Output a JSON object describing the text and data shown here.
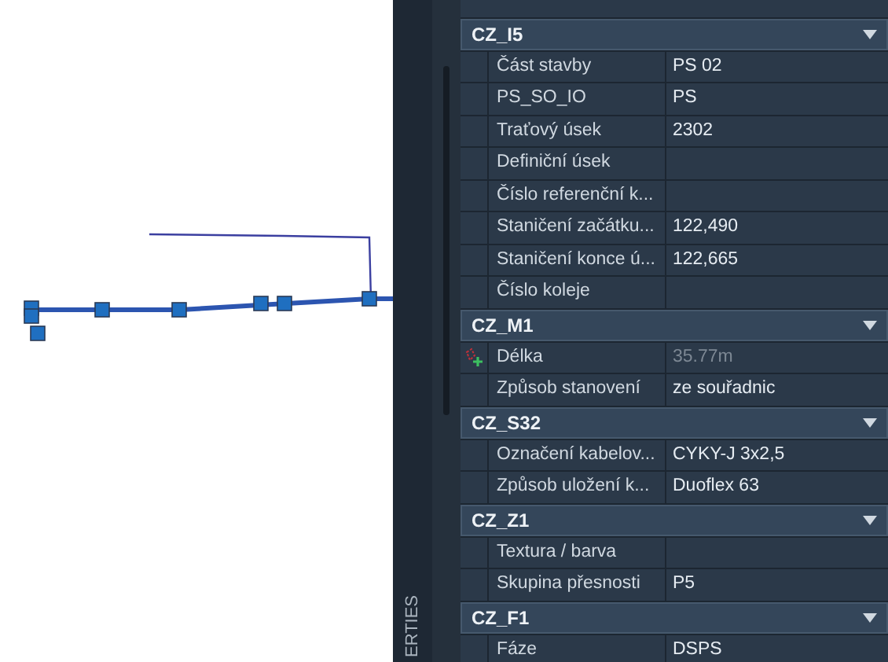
{
  "palette": {
    "tab_title": "ERTIES",
    "groups": [
      {
        "name": "CZ_I5",
        "expanded": true,
        "rows": [
          {
            "label": "Část stavby",
            "value": "PS 02",
            "disabled": false
          },
          {
            "label": "PS_SO_IO",
            "value": "PS",
            "disabled": false
          },
          {
            "label": "Traťový úsek",
            "value": "2302",
            "disabled": false
          },
          {
            "label": "Definiční úsek"
          },
          {
            "label": "Číslo referenční k..."
          },
          {
            "label": "Staničení začátku...",
            "value": "122,490",
            "disabled": false
          },
          {
            "label": "Staničení konce ú...",
            "value": "122,665",
            "disabled": false
          },
          {
            "label": "Číslo koleje"
          }
        ]
      },
      {
        "name": "CZ_M1",
        "expanded": true,
        "rows": [
          {
            "label": "Délka",
            "value": "35.77m",
            "disabled": true,
            "kind": "pick"
          },
          {
            "label": "Způsob stanovení",
            "value": "ze souřadnic",
            "disabled": false
          }
        ]
      },
      {
        "name": "CZ_S32",
        "expanded": true,
        "rows": [
          {
            "label": "Označení kabelov...",
            "value": "CYKY-J 3x2,5",
            "disabled": false
          },
          {
            "label": "Způsob uložení k...",
            "value": "Duoflex 63",
            "disabled": false
          }
        ]
      },
      {
        "name": "CZ_Z1",
        "expanded": true,
        "rows": [
          {
            "label": "Textura / barva"
          },
          {
            "label": "Skupina přesnosti",
            "value": "P5",
            "disabled": false
          }
        ]
      },
      {
        "name": "CZ_F1",
        "expanded": true,
        "rows": [
          {
            "label": "Fáze",
            "value": "DSPS",
            "disabled": false
          }
        ]
      }
    ]
  }
}
